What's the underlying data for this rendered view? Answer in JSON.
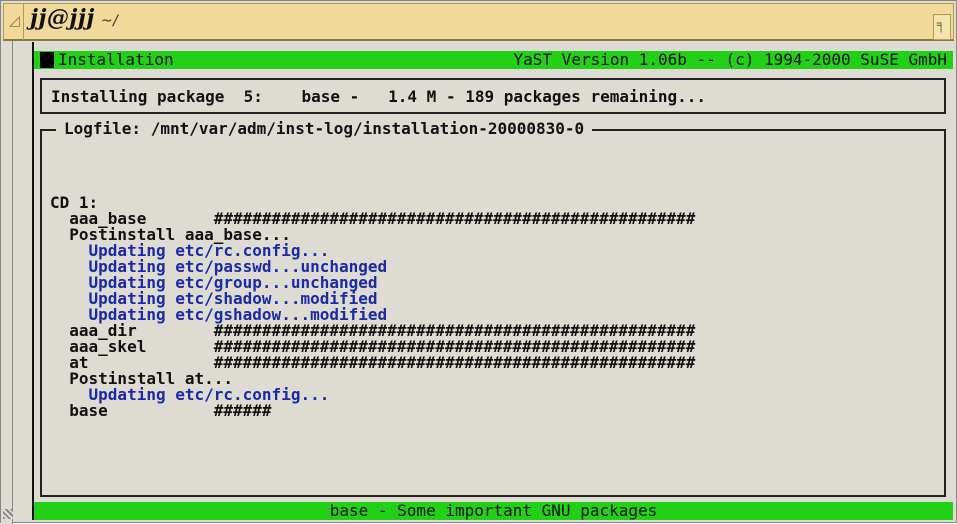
{
  "window": {
    "title": "jj@jjj",
    "title_path": "~/",
    "menu_glyph": "◿",
    "maximize_glyph": "╕"
  },
  "header": {
    "left": "Installation",
    "right": "YaST Version 1.06b -- (c) 1994-2000 SuSE GmbH"
  },
  "status": {
    "text": "Installing package  5:    base -   1.4 M - 189 packages remaining..."
  },
  "log": {
    "title": "Logfile: /mnt/var/adm/inst-log/installation-20000830-0",
    "lines": [
      {
        "text": "",
        "color": "black"
      },
      {
        "text": "CD 1:",
        "color": "black"
      },
      {
        "text": "  aaa_base       ##################################################",
        "color": "black"
      },
      {
        "text": "  Postinstall aaa_base...",
        "color": "black"
      },
      {
        "text": "    Updating etc/rc.config...",
        "color": "blue"
      },
      {
        "text": "    Updating etc/passwd...unchanged",
        "color": "blue"
      },
      {
        "text": "    Updating etc/group...unchanged",
        "color": "blue"
      },
      {
        "text": "    Updating etc/shadow...modified",
        "color": "blue"
      },
      {
        "text": "    Updating etc/gshadow...modified",
        "color": "blue"
      },
      {
        "text": "  aaa_dir        ##################################################",
        "color": "black"
      },
      {
        "text": "  aaa_skel       ##################################################",
        "color": "black"
      },
      {
        "text": "  at             ##################################################",
        "color": "black"
      },
      {
        "text": "  Postinstall at...",
        "color": "black"
      },
      {
        "text": "    Updating etc/rc.config...",
        "color": "blue"
      },
      {
        "text": "  base           ######",
        "color": "black"
      }
    ]
  },
  "footer": {
    "text": "base - Some important GNU packages"
  },
  "colors": {
    "green_bar": "#22d018",
    "terminal_bg": "#dedbd3",
    "blue_text": "#1a2aa8",
    "titlebar_bg": "#f0d99a"
  }
}
